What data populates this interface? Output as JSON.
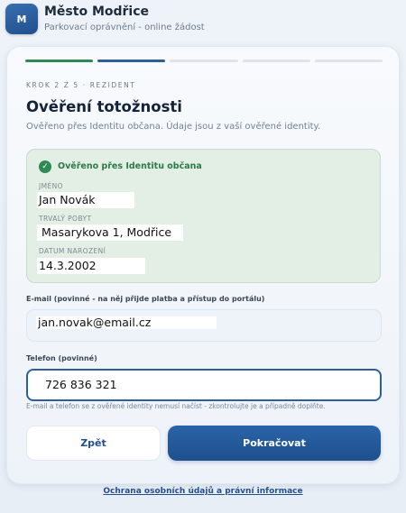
{
  "app": {
    "logo_letter": "M",
    "title": "Město Modřice",
    "subtitle": "Parkovací oprávnění - online žádost"
  },
  "progress": {
    "current_step": 2,
    "total_steps": 5
  },
  "step_label": "KROK 2 Z 5 · REZIDENT",
  "page_title": "Ověření totožnosti",
  "page_description": "Ověřeno přes Identitu občana. Údaje jsou z vaší ověřené identity.",
  "verified_box": {
    "title": "Ověřeno přes Identitu občana",
    "fields": [
      {
        "label": "JMÉNO",
        "value": "Jan Novák"
      },
      {
        "label": "TRVALÝ POBYT",
        "value": "Masarykova 1, Modřice"
      },
      {
        "label": "DATUM NAROZENÍ",
        "value": "14.3.2002"
      }
    ]
  },
  "email": {
    "label": "E-mail (povinné - na něj přijde platba a přístup do portálu)",
    "value": "jan.novak@email.cz"
  },
  "phone": {
    "label": "Telefon (povinné)",
    "value": "726 836 321"
  },
  "hint": "E-mail a telefon se z ověřené identity nemusí načíst - zkontrolujte je a případně doplňte.",
  "buttons": {
    "back": "Zpět",
    "next": "Pokračovat"
  },
  "footer_link": "Ochrana osobních údajů a právní informace",
  "colors": {
    "accent": "#2b5f9e",
    "success": "#2e8a55",
    "success_bg": "#e3efe5"
  }
}
